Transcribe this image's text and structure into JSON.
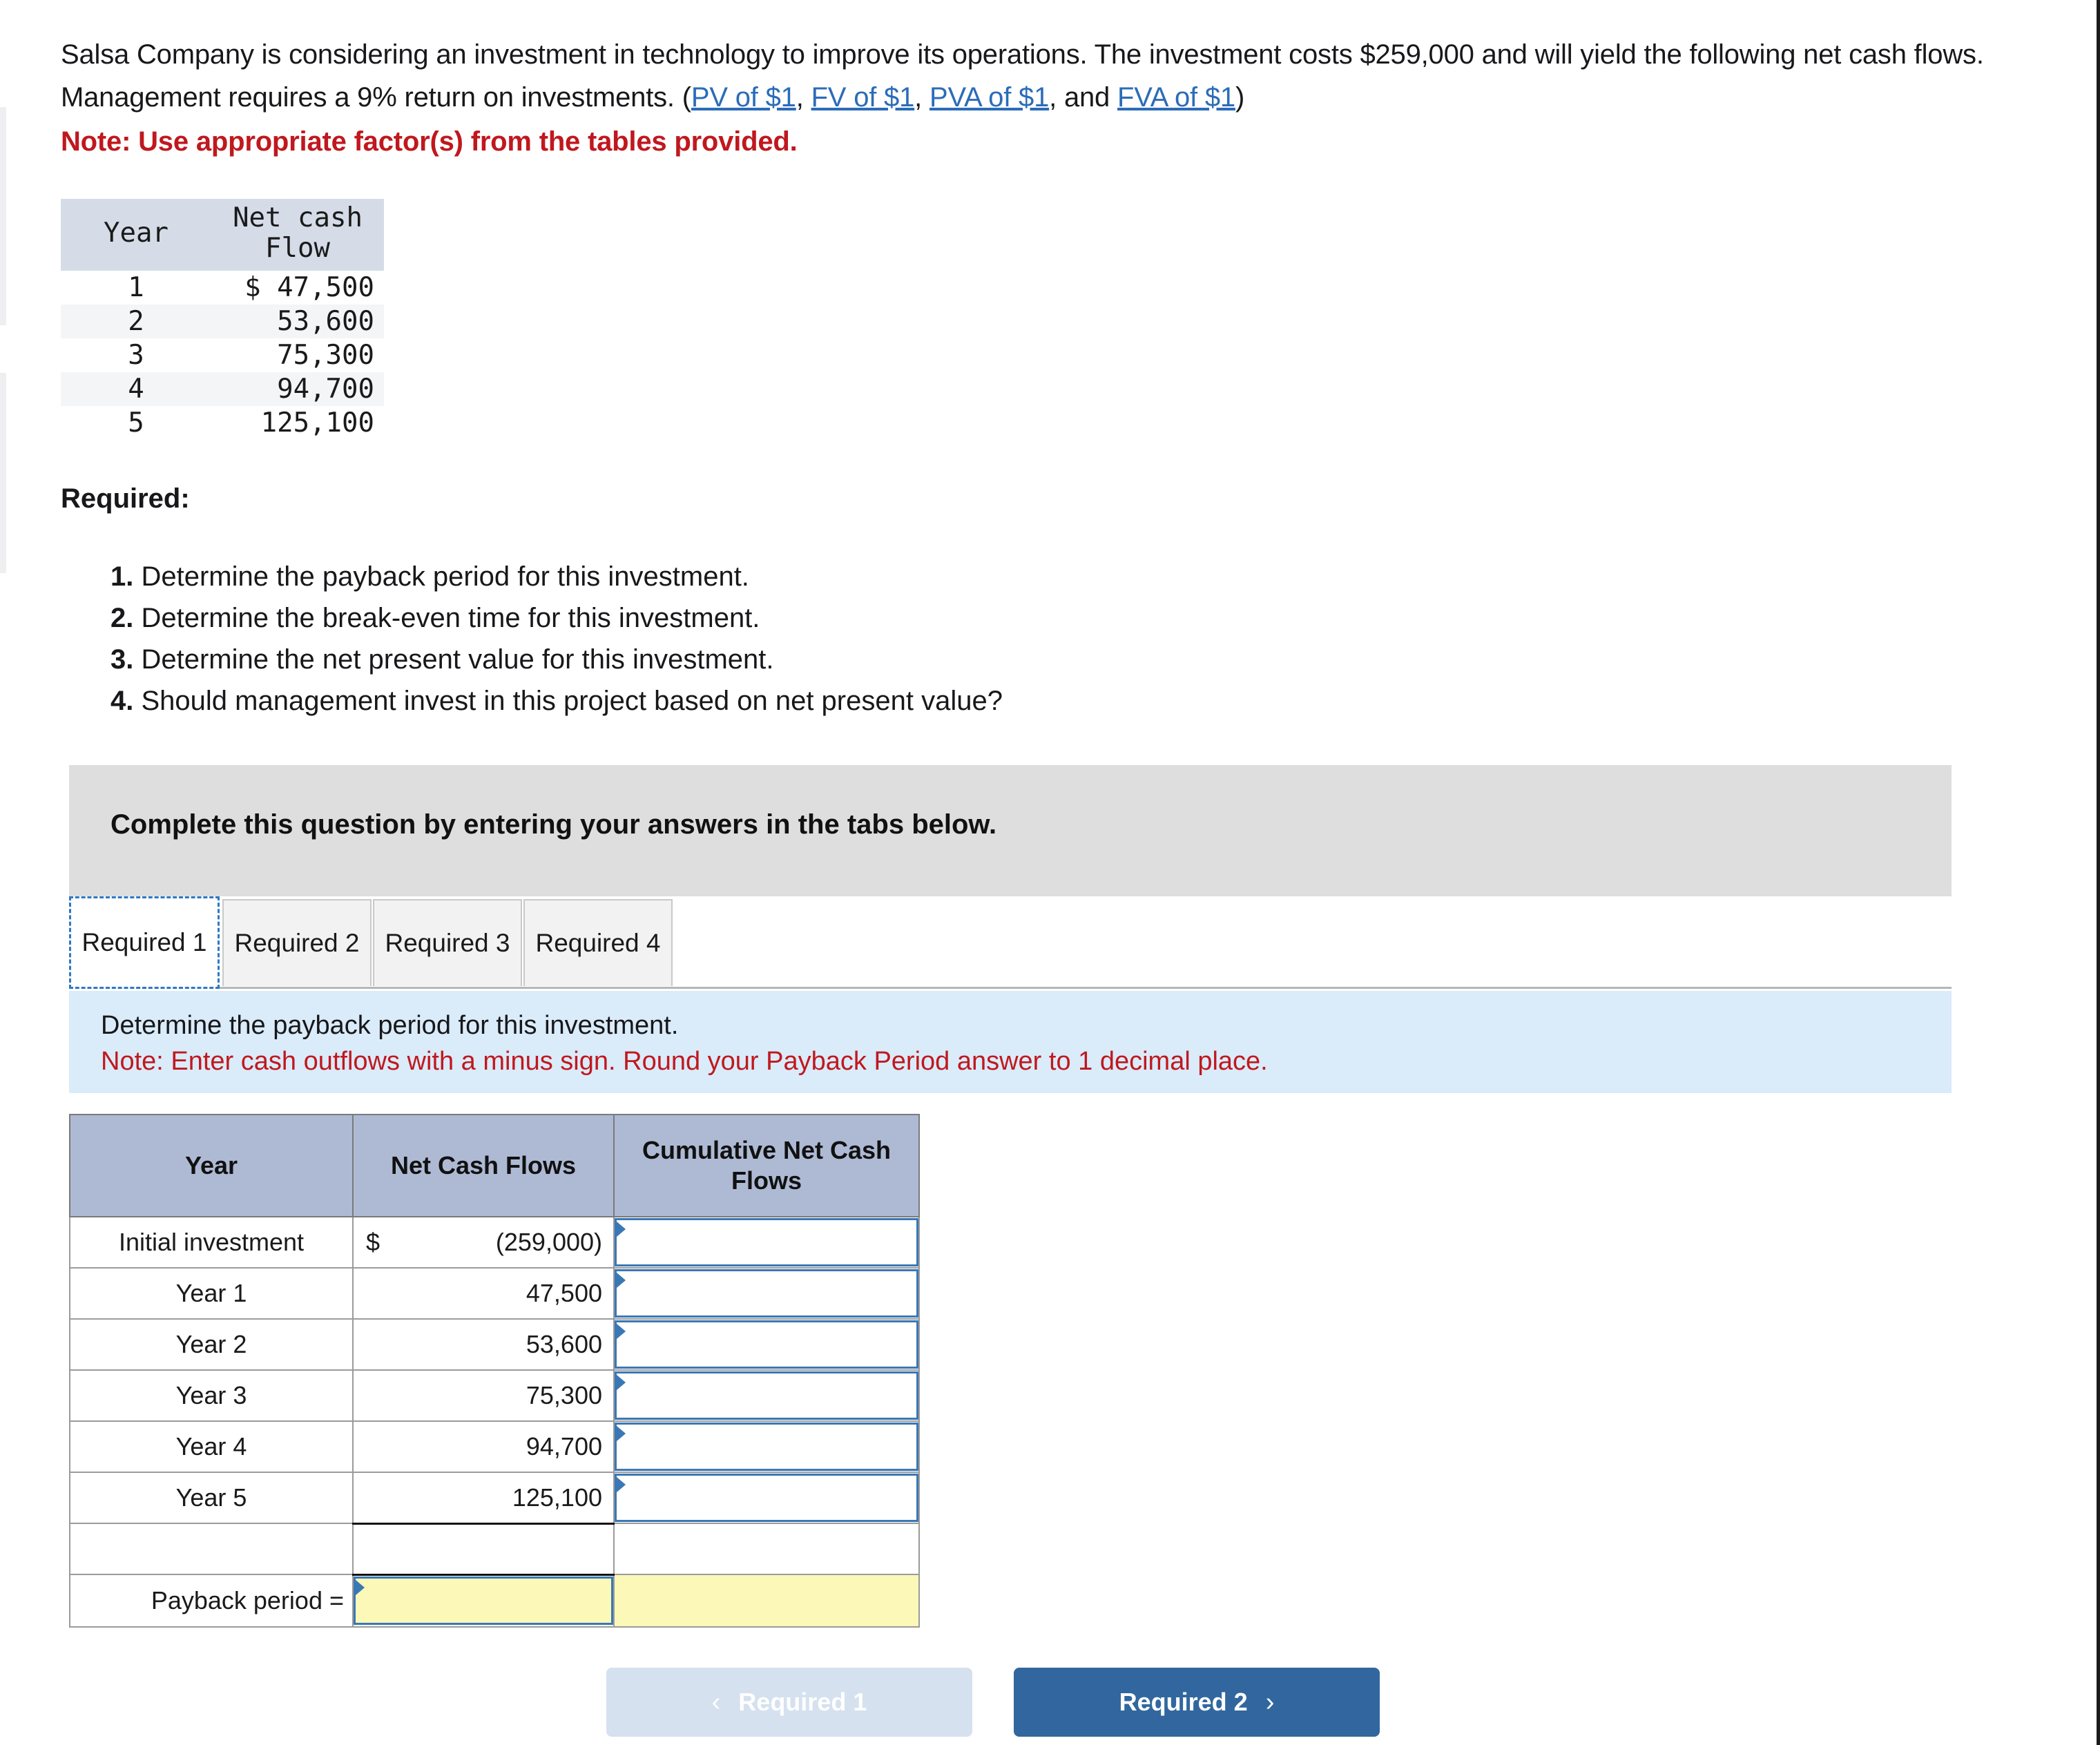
{
  "prompt": {
    "text_part1": "Salsa Company is considering an investment in technology to improve its operations. The investment costs $259,000 and will yield the following net cash flows. Management requires a 9% return on investments. (",
    "links": [
      "PV of $1",
      "FV of $1",
      "PVA of $1",
      "FVA of $1"
    ],
    "sep1": ", ",
    "sep2": ", ",
    "sep3": ", and ",
    "text_part2": ")",
    "note": "Note: Use appropriate factor(s) from the tables provided."
  },
  "data_table": {
    "headers": [
      "Year",
      "Net cash Flow"
    ],
    "header_year": "Year",
    "header_flow_line1": "Net cash",
    "header_flow_line2": "Flow",
    "rows": [
      {
        "year": "1",
        "flow": "$ 47,500"
      },
      {
        "year": "2",
        "flow": "53,600"
      },
      {
        "year": "3",
        "flow": "75,300"
      },
      {
        "year": "4",
        "flow": "94,700"
      },
      {
        "year": "5",
        "flow": "125,100"
      }
    ]
  },
  "required": {
    "heading": "Required:",
    "items": [
      {
        "num": "1.",
        "text": "Determine the payback period for this investment."
      },
      {
        "num": "2.",
        "text": "Determine the break-even time for this investment."
      },
      {
        "num": "3.",
        "text": "Determine the net present value for this investment."
      },
      {
        "num": "4.",
        "text": "Should management invest in this project based on net present value?"
      }
    ]
  },
  "banner": {
    "text": "Complete this question by entering your answers in the tabs below."
  },
  "tabs": {
    "items": [
      {
        "label": "Required 1",
        "active": true
      },
      {
        "label": "Required 2",
        "active": false
      },
      {
        "label": "Required 3",
        "active": false
      },
      {
        "label": "Required 4",
        "active": false
      }
    ]
  },
  "instruction": {
    "line1": "Determine the payback period for this investment.",
    "line2": "Note: Enter cash outflows with a minus sign. Round your Payback Period answer to 1 decimal place."
  },
  "answer_table": {
    "headers": {
      "year": "Year",
      "net_cash_flows": "Net Cash Flows",
      "cumulative_line1": "Cumulative Net Cash",
      "cumulative_line2": "Flows"
    },
    "rows": [
      {
        "label": "Initial investment",
        "dollar": "$",
        "value": "(259,000)",
        "cumulative": ""
      },
      {
        "label": "Year 1",
        "dollar": "",
        "value": "47,500",
        "cumulative": ""
      },
      {
        "label": "Year 2",
        "dollar": "",
        "value": "53,600",
        "cumulative": ""
      },
      {
        "label": "Year 3",
        "dollar": "",
        "value": "75,300",
        "cumulative": ""
      },
      {
        "label": "Year 4",
        "dollar": "",
        "value": "94,700",
        "cumulative": ""
      },
      {
        "label": "Year 5",
        "dollar": "",
        "value": "125,100",
        "cumulative": ""
      }
    ],
    "blank_row": {
      "label": "",
      "value": "",
      "cumulative": ""
    },
    "payback_row": {
      "label": "Payback period =",
      "value": "",
      "cumulative": ""
    }
  },
  "nav": {
    "prev_label": "Required 1",
    "prev_chevron": "‹",
    "next_label": "Required 2",
    "next_chevron": "›"
  },
  "colors": {
    "link": "#2b6cb8",
    "note_red": "#c0181e",
    "banner_gray": "#dededf",
    "instruction_blue": "#daebf9",
    "table_header_blue": "#aebad4",
    "input_border_blue": "#3a78b5",
    "input_yellow": "#fbf8b8",
    "next_button_blue": "#31679e",
    "prev_button_blue": "#d5e1ef"
  }
}
